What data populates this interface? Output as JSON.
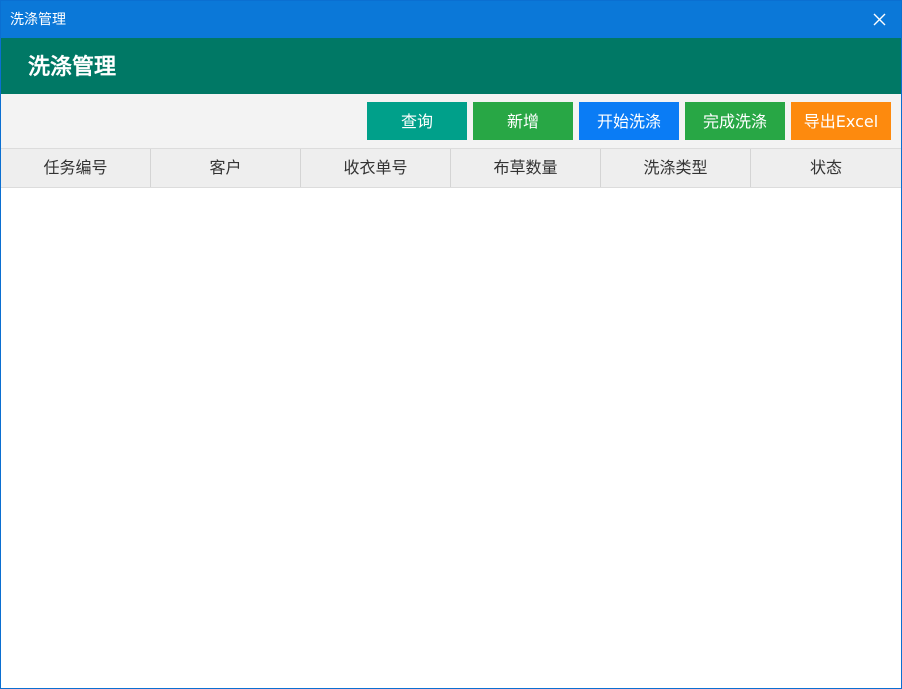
{
  "window": {
    "title": "洗涤管理"
  },
  "header": {
    "title": "洗涤管理"
  },
  "toolbar": {
    "buttons": [
      {
        "label": "查询",
        "color": "#00a08a"
      },
      {
        "label": "新增",
        "color": "#28a745"
      },
      {
        "label": "开始洗涤",
        "color": "#0a7cf5"
      },
      {
        "label": "完成洗涤",
        "color": "#28a745"
      },
      {
        "label": "导出Excel",
        "color": "#fd8a0e"
      }
    ]
  },
  "table": {
    "columns": [
      "任务编号",
      "客户",
      "收衣单号",
      "布草数量",
      "洗涤类型",
      "状态"
    ],
    "rows": []
  },
  "colors": {
    "titlebar": "#0b78d8",
    "header": "#007865",
    "toolbar": "#f3f3f3",
    "table_header": "#eeeeee"
  },
  "icons": {
    "close": "close-icon"
  }
}
